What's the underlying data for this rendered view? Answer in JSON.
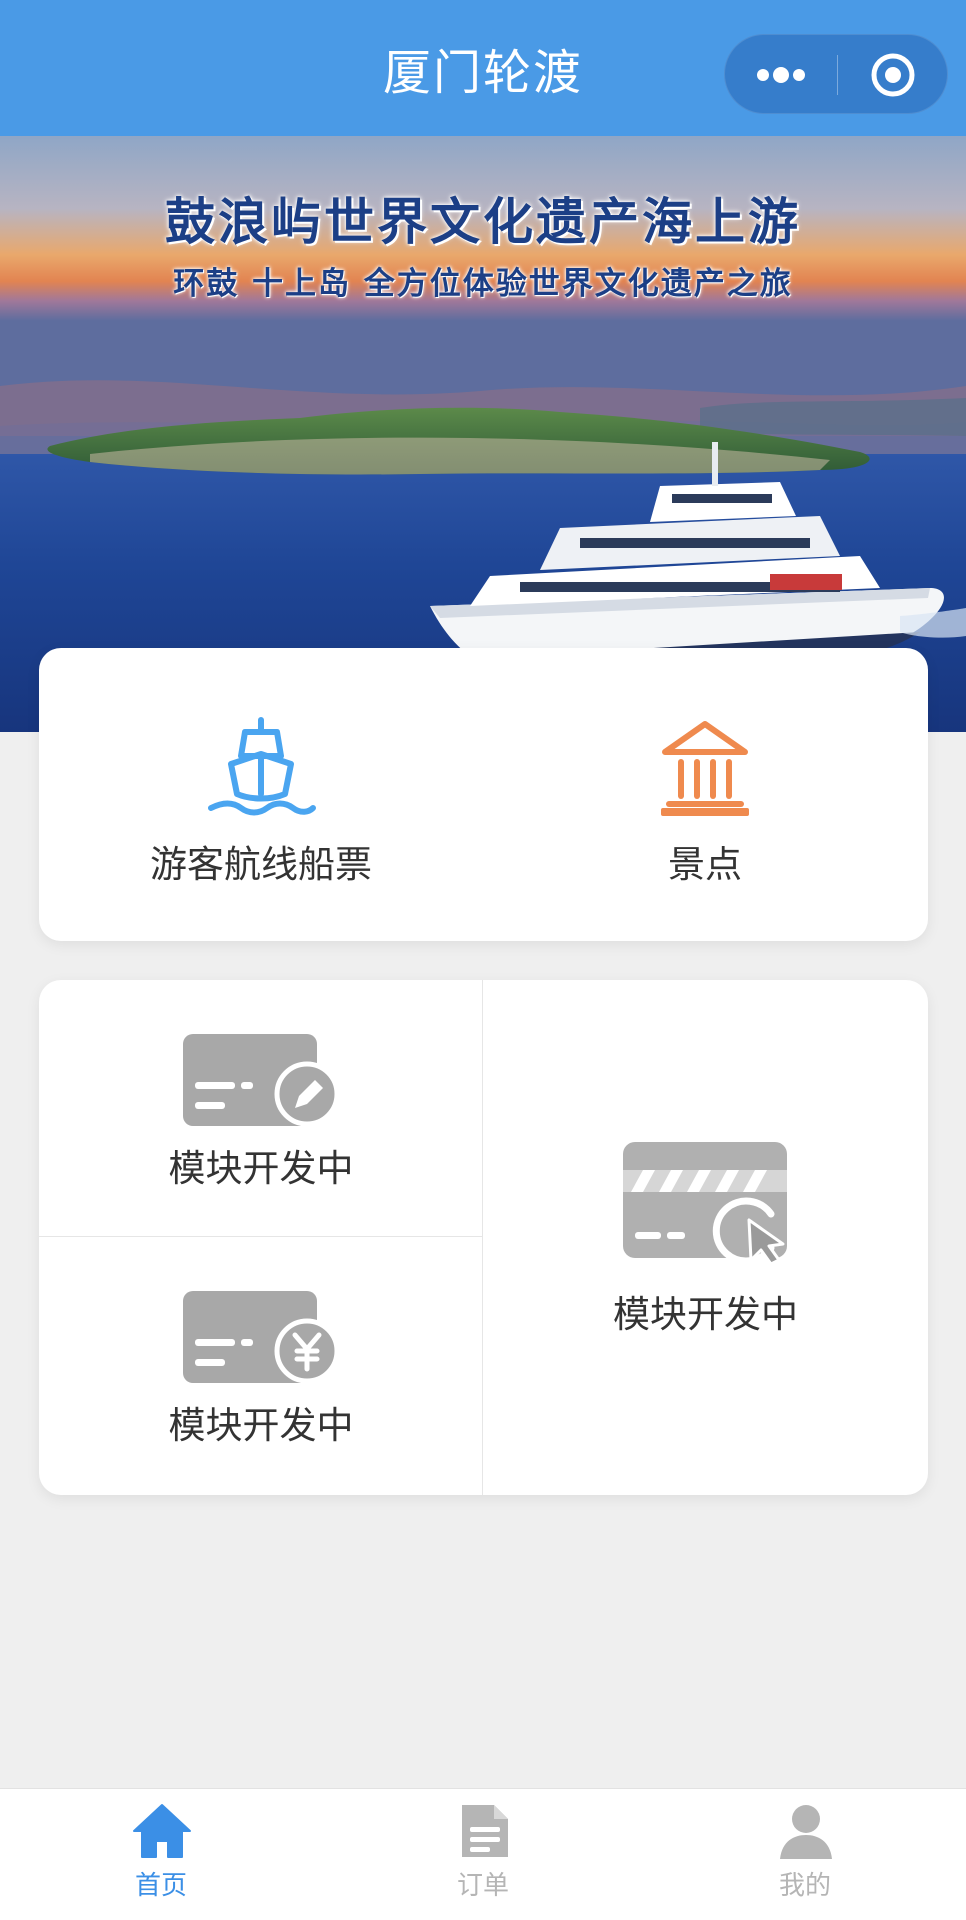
{
  "header": {
    "title": "厦门轮渡",
    "more_icon": "more-dots-icon",
    "close_icon": "target-circle-icon",
    "background": "#4a9ae6"
  },
  "banner": {
    "title": "鼓浪屿世界文化遗产海上游",
    "subtitle": "环鼓 十上岛  全方位体验世界文化遗产之旅"
  },
  "entries": [
    {
      "label": "游客航线船票",
      "icon": "ship-icon",
      "color": "#4aa5f0"
    },
    {
      "label": "景点",
      "icon": "museum-icon",
      "color": "#ef8a4e"
    }
  ],
  "modules": [
    {
      "label": "模块开发中",
      "icon": "card-edit-icon"
    },
    {
      "label": "模块开发中",
      "icon": "card-yuan-icon"
    },
    {
      "label": "模块开发中",
      "icon": "card-click-icon"
    }
  ],
  "tabbar": {
    "active_color": "#3b8fe6",
    "inactive_color": "#b5b5b5",
    "items": [
      {
        "label": "首页",
        "icon": "home-icon",
        "active": true
      },
      {
        "label": "订单",
        "icon": "document-icon",
        "active": false
      },
      {
        "label": "我的",
        "icon": "user-icon",
        "active": false
      }
    ]
  }
}
